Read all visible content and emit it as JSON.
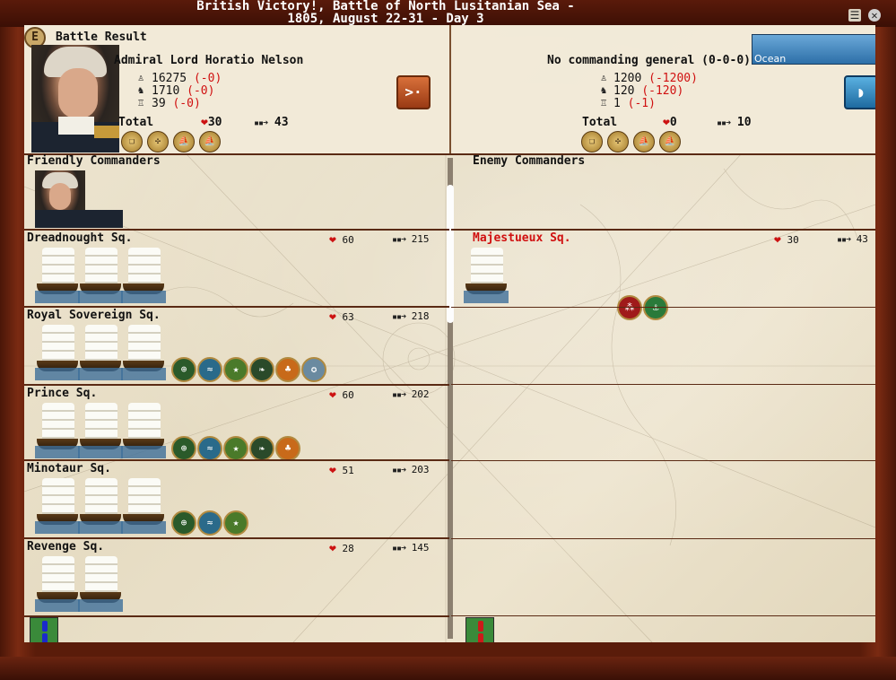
{
  "window": {
    "title_line1": "British Victory!, Battle of North Lusitanian Sea -",
    "title_line2": "1805, August 22-31 - Day 3",
    "menu_icon": "menu-icon",
    "close_icon": "close-icon"
  },
  "header": {
    "badge_letter": "E",
    "battle_result_label": "Battle Result",
    "ocean_label": "Ocean"
  },
  "friendly": {
    "commander_name": "Admiral Lord Horatio Nelson",
    "stats": [
      {
        "value": "16275",
        "delta": "(-0)"
      },
      {
        "value": "1710",
        "delta": "(-0)"
      },
      {
        "value": "39",
        "delta": "(-0)"
      }
    ],
    "total_label": "Total",
    "total_hits": "30",
    "total_power": "43",
    "section_title": "Friendly Commanders",
    "squadrons": [
      {
        "name": "Dreadnought Sq.",
        "hits": "60",
        "power": "215",
        "ships": 3,
        "skills": []
      },
      {
        "name": "Royal Sovereign Sq.",
        "hits": "63",
        "power": "218",
        "ships": 3,
        "skills": [
          "crosshair-icon",
          "wind-icon",
          "star-icon",
          "leaf-icon",
          "clover-icon",
          "medal-icon"
        ]
      },
      {
        "name": "Prince Sq.",
        "hits": "60",
        "power": "202",
        "ships": 3,
        "skills": [
          "crosshair-icon",
          "wind-icon",
          "star-icon",
          "leaf-icon",
          "clover-icon"
        ]
      },
      {
        "name": "Minotaur Sq.",
        "hits": "51",
        "power": "203",
        "ships": 3,
        "skills": [
          "crosshair-icon",
          "wind-icon",
          "star-icon"
        ]
      },
      {
        "name": "Revenge Sq.",
        "hits": "28",
        "power": "145",
        "ships": 2,
        "skills": []
      }
    ]
  },
  "enemy": {
    "commander_name": "No commanding general (0-0-0)",
    "stats": [
      {
        "value": "1200",
        "delta": "(-1200)"
      },
      {
        "value": "120",
        "delta": "(-120)"
      },
      {
        "value": "1",
        "delta": "(-1)"
      }
    ],
    "total_label": "Total",
    "total_hits": "0",
    "total_power": "10",
    "section_title": "Enemy Commanders",
    "squadrons": [
      {
        "name": "Majestueux Sq.",
        "hits": "30",
        "power": "43",
        "ships": 1,
        "skills": [
          "grapeshot-icon",
          "anchor-icon"
        ]
      }
    ]
  },
  "colors": {
    "frame": "#5a1c0a",
    "parchment": "#eee6d2",
    "enemy_name": "#d01010",
    "friendly_morale": "#1a2acc",
    "enemy_morale": "#cc1a1a"
  }
}
